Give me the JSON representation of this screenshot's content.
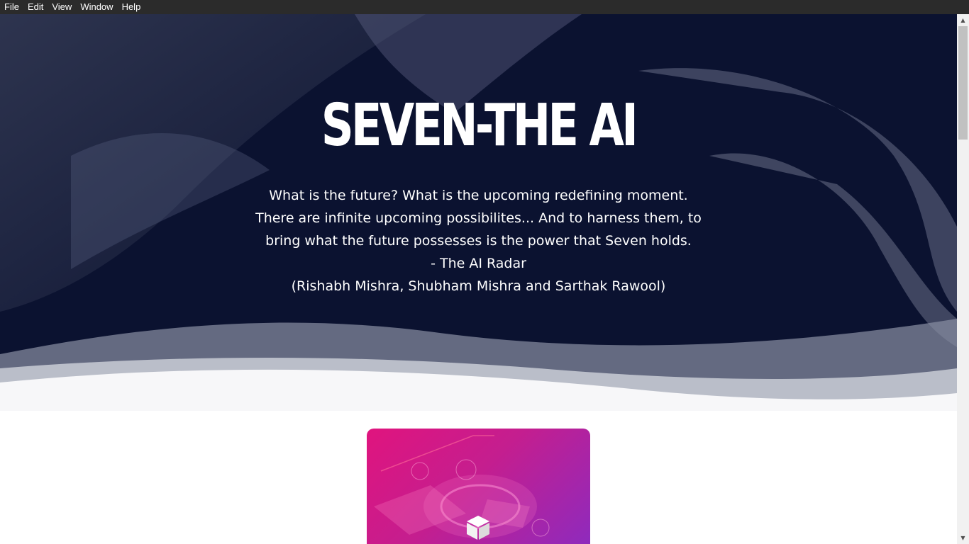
{
  "menubar": {
    "items": [
      "File",
      "Edit",
      "View",
      "Window",
      "Help"
    ]
  },
  "hero": {
    "title": "SEVEN-THE AI",
    "lines": [
      "What is the future? What is the upcoming redefining moment.",
      "There are infinite upcoming possibilites... And to harness them, to",
      "bring what the future possesses is the power that Seven holds.",
      "- The AI Radar",
      "(Rishabh Mishra, Shubham Mishra and Sarthak Rawool)"
    ]
  },
  "card": {
    "icon": "cube-icon",
    "accent": "#e0147e"
  },
  "colors": {
    "hero_background": "#0b1230",
    "menubar": "#2b2b2b"
  }
}
